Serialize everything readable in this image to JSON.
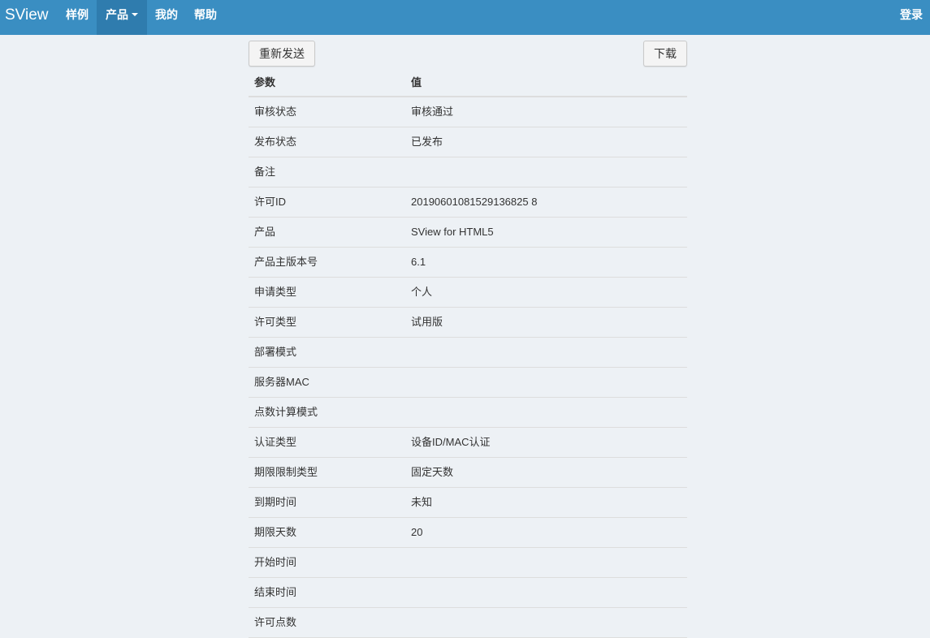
{
  "nav": {
    "brand": "SView",
    "items": [
      {
        "label": "样例"
      },
      {
        "label": "产品"
      },
      {
        "label": "我的"
      },
      {
        "label": "帮助"
      }
    ],
    "login": "登录"
  },
  "toolbar": {
    "resend_label": "重新发送",
    "download_label": "下载"
  },
  "table": {
    "headers": [
      "参数",
      "值"
    ],
    "rows": [
      {
        "key": "审核状态",
        "value": "审核通过"
      },
      {
        "key": "发布状态",
        "value": "已发布"
      },
      {
        "key": "备注",
        "value": ""
      },
      {
        "key": "许可ID",
        "value": "20190601081529136825 8"
      },
      {
        "key": "产品",
        "value": "SView for HTML5"
      },
      {
        "key": "产品主版本号",
        "value": "6.1"
      },
      {
        "key": "申请类型",
        "value": "个人"
      },
      {
        "key": "许可类型",
        "value": "试用版"
      },
      {
        "key": "部署模式",
        "value": ""
      },
      {
        "key": "服务器MAC",
        "value": ""
      },
      {
        "key": "点数计算模式",
        "value": ""
      },
      {
        "key": "认证类型",
        "value": "设备ID/MAC认证"
      },
      {
        "key": "期限限制类型",
        "value": "固定天数"
      },
      {
        "key": "到期时间",
        "value": "未知"
      },
      {
        "key": "期限天数",
        "value": "20"
      },
      {
        "key": "开始时间",
        "value": ""
      },
      {
        "key": "结束时间",
        "value": ""
      },
      {
        "key": "许可点数",
        "value": ""
      }
    ]
  },
  "colors": {
    "navbar": "#3a8ec2",
    "navbar_active": "#2f7cae",
    "page_background": "#edf1f5",
    "row_border": "#dddddd"
  }
}
